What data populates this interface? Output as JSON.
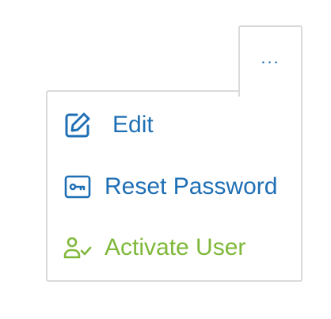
{
  "trigger": {
    "label": "...",
    "icon": "kebab-icon",
    "color": "#1f6fb5"
  },
  "menu": {
    "items": [
      {
        "id": "edit",
        "label": "Edit",
        "icon": "edit-icon",
        "color": "#1f6fb5"
      },
      {
        "id": "reset-password",
        "label": "Reset Password",
        "icon": "key-icon",
        "color": "#1f6fb5"
      },
      {
        "id": "activate-user",
        "label": "Activate User",
        "icon": "user-check-icon",
        "color": "#7fb83a"
      }
    ]
  },
  "border_color": "#d9dadc"
}
